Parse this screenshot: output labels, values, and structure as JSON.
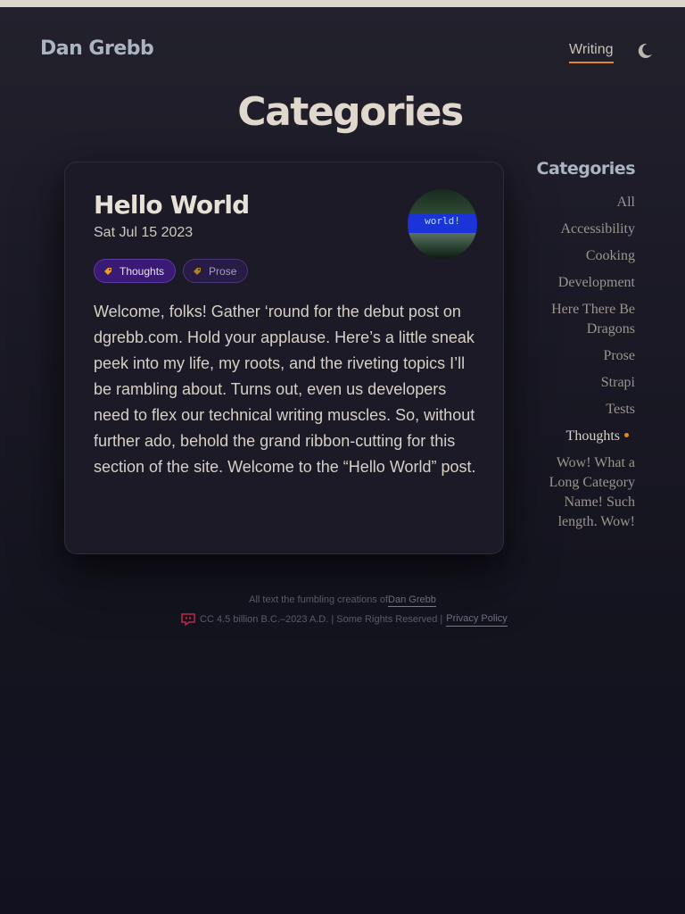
{
  "site": {
    "title": "Dan Grebb"
  },
  "nav": {
    "writing": "Writing"
  },
  "theme_toggle_icon": "moon-icon",
  "page": {
    "title": "Categories"
  },
  "post": {
    "title": "Hello World",
    "date": "Sat Jul 15 2023",
    "avatar_text": "world!",
    "tags": [
      {
        "label": "Thoughts",
        "icon": "tag-icon"
      },
      {
        "label": "Prose",
        "icon": "tag-icon"
      }
    ],
    "excerpt": "Welcome, folks! Gather ‘round for the debut post on dgrebb.com. Hold your applause. Here’s a little sneak peek into my life, my roots, and the riveting topics I’ll be rambling about. Turns out, even us developers need to flex our technical writing muscles. So, without further ado, behold the grand ribbon-cutting for this section of the site. Welcome to the “Hello World” post."
  },
  "sidebar": {
    "title": "Categories",
    "items": [
      {
        "label": "All"
      },
      {
        "label": "Accessibility"
      },
      {
        "label": "Cooking"
      },
      {
        "label": "Development"
      },
      {
        "label": "Here There Be Dragons"
      },
      {
        "label": "Prose"
      },
      {
        "label": "Strapi"
      },
      {
        "label": "Tests"
      },
      {
        "label": "Thoughts",
        "active": true
      },
      {
        "label": "Wow! What a Long Category Name! Such length. Wow!"
      }
    ]
  },
  "footer": {
    "line1_prefix": "All text the fumbling creations of",
    "author": "Dan Grebb",
    "line2": "CC 4.5 billion B.C.–2023 A.D. | Some Rights Reserved |",
    "privacy": "Privacy Policy"
  },
  "colors": {
    "accent": "#e08a2c",
    "tag_thoughts": "#3a1a74",
    "tag_prose": "#281c46",
    "cc_icon": "#c0264a"
  }
}
